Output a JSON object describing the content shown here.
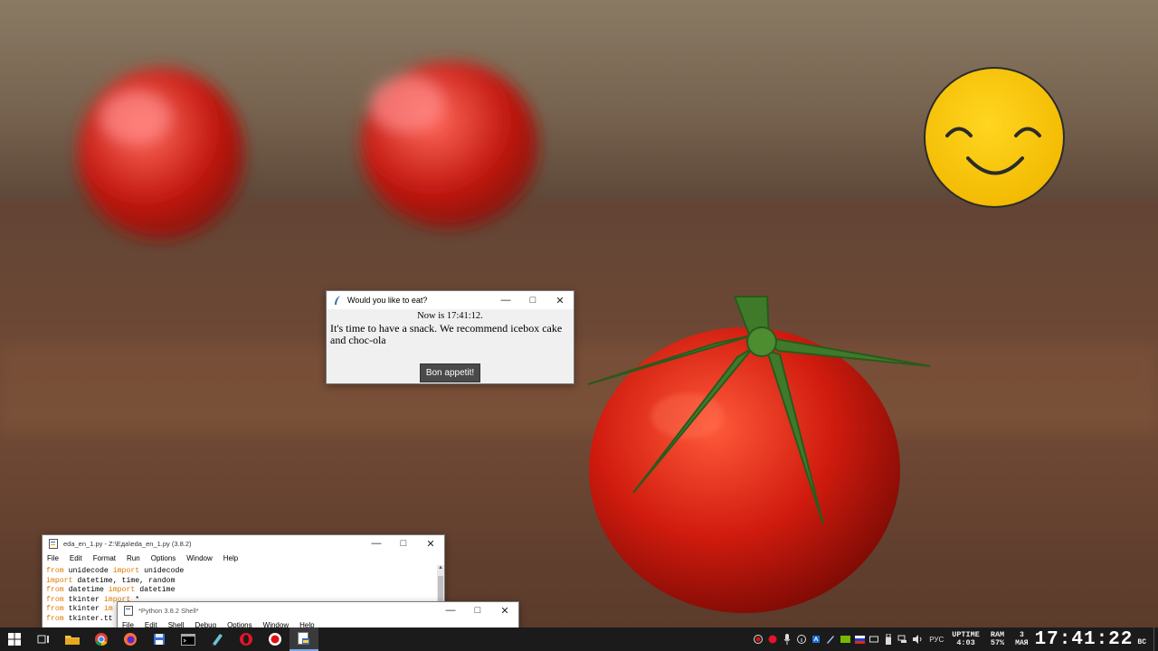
{
  "dialog": {
    "title": "Would you like to eat?",
    "now_line": "Now is 17:41:12.",
    "message": "It's time to have a snack. We recommend icebox cake and choc-ola",
    "button": "Bon appetit!"
  },
  "editor": {
    "title": "eda_en_1.py - Z:\\Еда\\eda_en_1.py (3.8.2)",
    "menu": [
      "File",
      "Edit",
      "Format",
      "Run",
      "Options",
      "Window",
      "Help"
    ],
    "lines": [
      {
        "kw1": "from",
        "mid": " unidecode ",
        "kw2": "import",
        "rest": " unidecode"
      },
      {
        "kw1": "import",
        "mid": " datetime, time, random",
        "kw2": "",
        "rest": ""
      },
      {
        "kw1": "from",
        "mid": " datetime ",
        "kw2": "import",
        "rest": " datetime"
      },
      {
        "kw1": "from",
        "mid": " tkinter ",
        "kw2": "import",
        "rest": " *"
      },
      {
        "kw1": "from",
        "mid": " tkinter ",
        "kw2": "im",
        "rest": ""
      },
      {
        "kw1": "from",
        "mid": " tkinter.tt",
        "kw2": "",
        "rest": ""
      }
    ]
  },
  "shell": {
    "title": "*Python 3.8.2 Shell*",
    "menu": [
      "File",
      "Edit",
      "Shell",
      "Debug",
      "Options",
      "Window",
      "Help"
    ]
  },
  "taskbar": {
    "lang": "РУС",
    "uptime_label": "UPTIME",
    "uptime_value": "4:03",
    "ram_label": "RAM",
    "ram_value": "57%",
    "date_day": "3",
    "date_month": "МАЯ",
    "time": "17:41:22",
    "weekday": "ВС"
  },
  "colors": {
    "taskbar_bg": "#1b1b1b",
    "tomato_red": "#d01b0e",
    "stem_green": "#3f7a2a",
    "smiley_yellow": "#ffcc00",
    "keyword_orange": "#e07800"
  }
}
